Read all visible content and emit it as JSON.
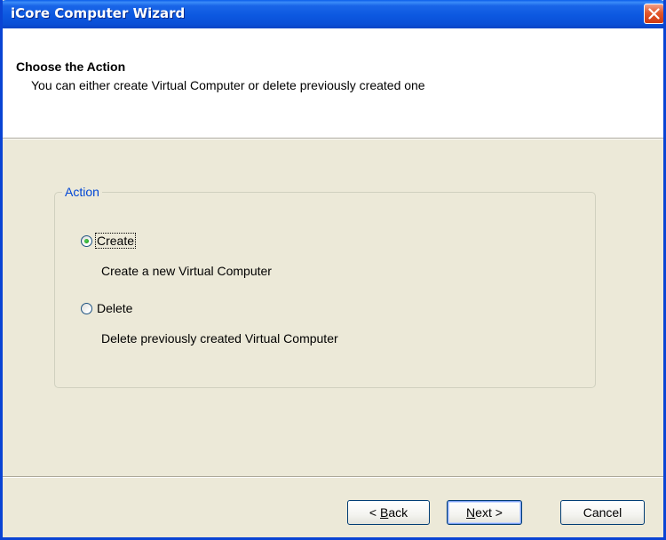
{
  "window": {
    "title": "iCore Computer Wizard"
  },
  "header": {
    "title": "Choose the Action",
    "subtitle": "You can either create Virtual Computer or delete previously created one"
  },
  "action_group": {
    "legend": "Action",
    "options": [
      {
        "label": "Create",
        "description": "Create a new Virtual Computer",
        "checked": true
      },
      {
        "label": "Delete",
        "description": "Delete previously created Virtual Computer",
        "checked": false
      }
    ]
  },
  "buttons": {
    "back": {
      "label_prefix": "< ",
      "mnemonic": "B",
      "label_rest": "ack"
    },
    "next": {
      "mnemonic": "N",
      "label_rest": "ext",
      "label_suffix": " >"
    },
    "cancel": {
      "label": "Cancel"
    }
  },
  "colors": {
    "title_bar": "#0c58e0",
    "face": "#ece9d8",
    "group_legend": "#0046d5",
    "radio_dot": "#21a121",
    "close_button": "#e2582c"
  },
  "icons": {
    "close": "close-icon"
  }
}
